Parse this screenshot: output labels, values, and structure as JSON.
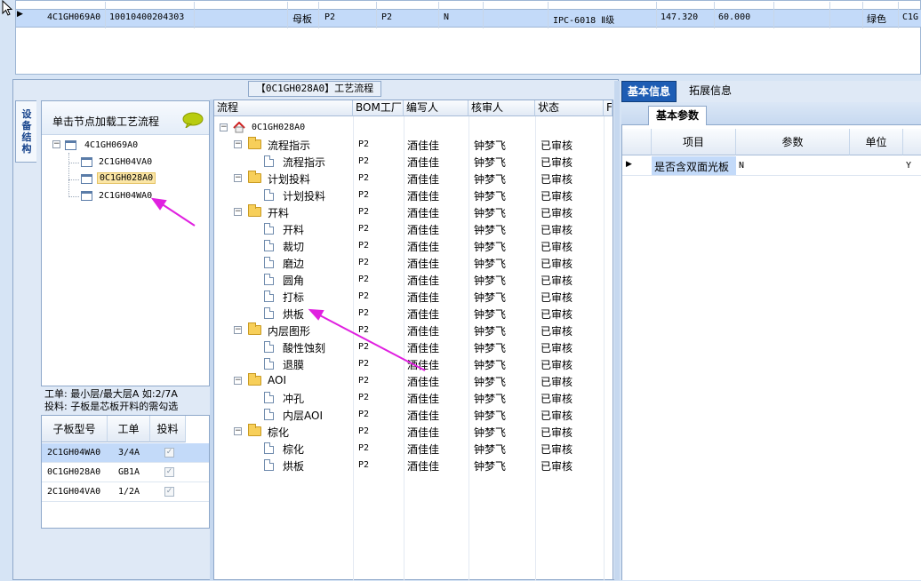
{
  "top_row": {
    "cells": [
      "4C1GH069A0",
      "10010400204303",
      "母板",
      "P2",
      "P2",
      "N",
      "IPC-6018 Ⅱ级",
      "147.320",
      "60.000",
      "绿色",
      "C1G"
    ]
  },
  "flow_panel_title": "【0C1GH028A0】工艺流程",
  "side_tab_label": "设备结构",
  "tree": {
    "hint": "单击节点加载工艺流程",
    "root": "4C1GH069A0",
    "children": [
      "2C1GH04VA0",
      "0C1GH028A0",
      "2C1GH04WA0"
    ],
    "selected_index": 1
  },
  "info": {
    "line1": "工单: 最小层/最大层A 如:2/7A",
    "line2": "投料: 子板是芯板开料的需勾选"
  },
  "sub_grid": {
    "headers": [
      "子板型号",
      "工单",
      "投料"
    ],
    "rows": [
      {
        "model": "2C1GH04WA0",
        "order": "3/4A",
        "feed": true
      },
      {
        "model": "0C1GH028A0",
        "order": "GB1A",
        "feed": true
      },
      {
        "model": "2C1GH04VA0",
        "order": "1/2A",
        "feed": true
      }
    ]
  },
  "flow_grid": {
    "headers": [
      "流程",
      "BOM工厂",
      "编写人",
      "核审人",
      "状态",
      "F"
    ],
    "root": "0C1GH028A0",
    "rows": [
      {
        "name": "流程指示",
        "type": "folder",
        "bom": "P2",
        "author": "酒佳佳",
        "reviewer": "钟梦飞",
        "status": "已审核"
      },
      {
        "name": "流程指示",
        "type": "doc",
        "bom": "P2",
        "author": "酒佳佳",
        "reviewer": "钟梦飞",
        "status": "已审核"
      },
      {
        "name": "计划投料",
        "type": "folder",
        "bom": "P2",
        "author": "酒佳佳",
        "reviewer": "钟梦飞",
        "status": "已审核"
      },
      {
        "name": "计划投料",
        "type": "doc",
        "bom": "P2",
        "author": "酒佳佳",
        "reviewer": "钟梦飞",
        "status": "已审核"
      },
      {
        "name": "开料",
        "type": "folder",
        "bom": "P2",
        "author": "酒佳佳",
        "reviewer": "钟梦飞",
        "status": "已审核"
      },
      {
        "name": "开料",
        "type": "doc",
        "bom": "P2",
        "author": "酒佳佳",
        "reviewer": "钟梦飞",
        "status": "已审核"
      },
      {
        "name": "裁切",
        "type": "doc",
        "bom": "P2",
        "author": "酒佳佳",
        "reviewer": "钟梦飞",
        "status": "已审核"
      },
      {
        "name": "磨边",
        "type": "doc",
        "bom": "P2",
        "author": "酒佳佳",
        "reviewer": "钟梦飞",
        "status": "已审核"
      },
      {
        "name": "圆角",
        "type": "doc",
        "bom": "P2",
        "author": "酒佳佳",
        "reviewer": "钟梦飞",
        "status": "已审核"
      },
      {
        "name": "打标",
        "type": "doc",
        "bom": "P2",
        "author": "酒佳佳",
        "reviewer": "钟梦飞",
        "status": "已审核"
      },
      {
        "name": "烘板",
        "type": "doc",
        "bom": "P2",
        "author": "酒佳佳",
        "reviewer": "钟梦飞",
        "status": "已审核"
      },
      {
        "name": "内层图形",
        "type": "folder",
        "bom": "P2",
        "author": "酒佳佳",
        "reviewer": "钟梦飞",
        "status": "已审核"
      },
      {
        "name": "酸性蚀刻",
        "type": "doc",
        "bom": "P2",
        "author": "酒佳佳",
        "reviewer": "钟梦飞",
        "status": "已审核"
      },
      {
        "name": "退膜",
        "type": "doc",
        "bom": "P2",
        "author": "酒佳佳",
        "reviewer": "钟梦飞",
        "status": "已审核"
      },
      {
        "name": "AOI",
        "type": "folder",
        "bom": "P2",
        "author": "酒佳佳",
        "reviewer": "钟梦飞",
        "status": "已审核"
      },
      {
        "name": "冲孔",
        "type": "doc",
        "bom": "P2",
        "author": "酒佳佳",
        "reviewer": "钟梦飞",
        "status": "已审核"
      },
      {
        "name": "内层AOI",
        "type": "doc",
        "bom": "P2",
        "author": "酒佳佳",
        "reviewer": "钟梦飞",
        "status": "已审核"
      },
      {
        "name": "棕化",
        "type": "folder",
        "bom": "P2",
        "author": "酒佳佳",
        "reviewer": "钟梦飞",
        "status": "已审核"
      },
      {
        "name": "棕化",
        "type": "doc",
        "bom": "P2",
        "author": "酒佳佳",
        "reviewer": "钟梦飞",
        "status": "已审核"
      },
      {
        "name": "烘板",
        "type": "doc",
        "bom": "P2",
        "author": "酒佳佳",
        "reviewer": "钟梦飞",
        "status": "已审核"
      }
    ]
  },
  "right_tabs": [
    "基本信息",
    "拓展信息"
  ],
  "right_subtab": "基本参数",
  "param_grid": {
    "headers": [
      "项目",
      "参数",
      "单位"
    ],
    "row": {
      "item": "是否含双面光板",
      "value": "N",
      "unit": "",
      "extra": "Y"
    }
  },
  "colors": {
    "selected_row": "#c3daf9",
    "tab_active": "#1e5db4",
    "arrow": "#e020e0"
  }
}
